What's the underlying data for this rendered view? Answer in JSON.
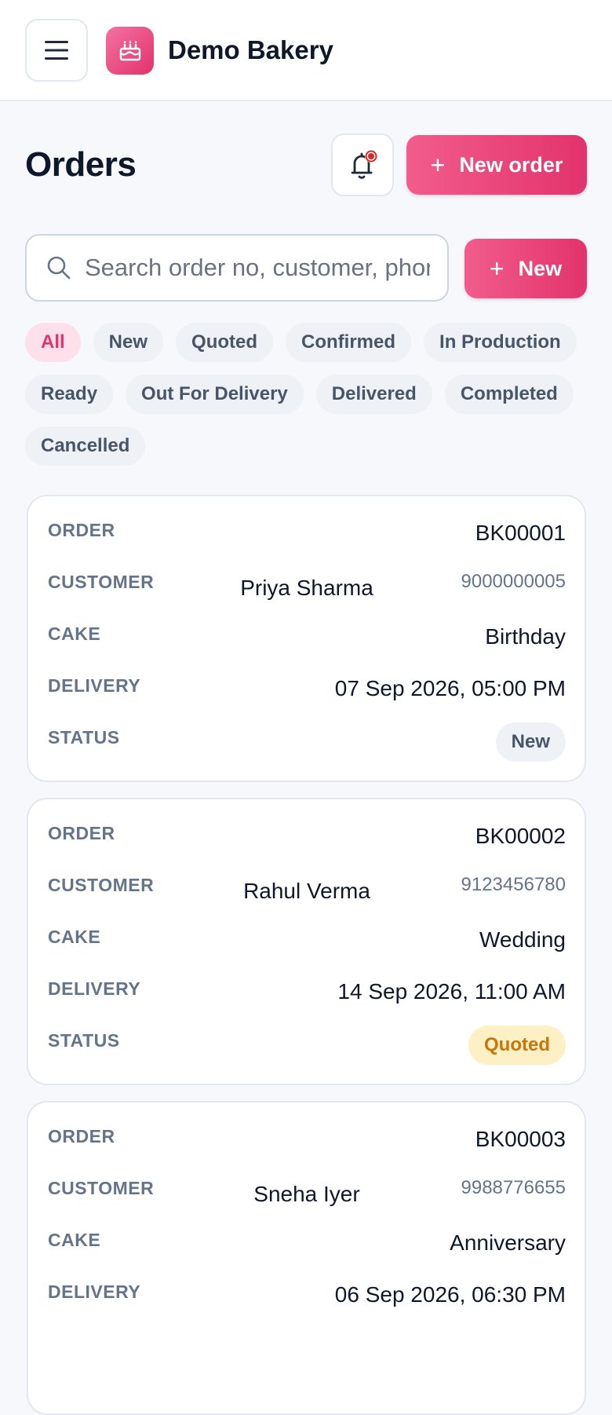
{
  "header": {
    "brand": "Demo Bakery"
  },
  "page": {
    "title": "Orders",
    "new_order_label": "New order",
    "new_label": "New",
    "plus": "+"
  },
  "search": {
    "placeholder": "Search order no, customer, phone"
  },
  "filters": [
    "All",
    "New",
    "Quoted",
    "Confirmed",
    "In Production",
    "Ready",
    "Out For Delivery",
    "Delivered",
    "Completed",
    "Cancelled"
  ],
  "active_filter": "All",
  "labels": {
    "order": "ORDER",
    "customer": "CUSTOMER",
    "cake": "CAKE",
    "delivery": "DELIVERY",
    "status": "STATUS"
  },
  "orders": [
    {
      "order_no": "BK00001",
      "customer": "Priya Sharma",
      "phone": "9000000005",
      "cake": "Birthday",
      "delivery": "07 Sep 2026, 05:00 PM",
      "status": "New"
    },
    {
      "order_no": "BK00002",
      "customer": "Rahul Verma",
      "phone": "9123456780",
      "cake": "Wedding",
      "delivery": "14 Sep 2026, 11:00 AM",
      "status": "Quoted"
    },
    {
      "order_no": "BK00003",
      "customer": "Sneha Iyer",
      "phone": "9988776655",
      "cake": "Anniversary",
      "delivery": "06 Sep 2026, 06:30 PM",
      "status": ""
    }
  ],
  "colors": {
    "accent": "#e2336d",
    "accent_light": "#f25c8d",
    "notification_dot": "#dc2626",
    "quoted_text": "#c8760a",
    "quoted_bg": "#fdf0c4"
  },
  "icons": {
    "menu": "hamburger-menu-icon",
    "logo": "cake-icon",
    "bell": "bell-icon",
    "search": "search-icon"
  }
}
